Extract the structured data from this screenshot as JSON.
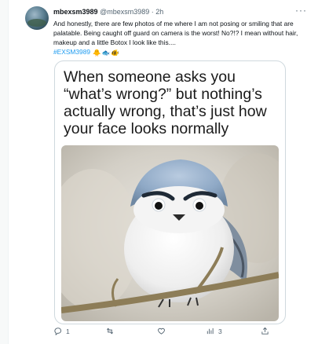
{
  "tweet": {
    "name": "mbexsm3989",
    "handle": "@mbexsm3989",
    "separator": "·",
    "time": "2h",
    "more_label": "···",
    "text": "And honestly, there are few photos of me where I am not posing or smiling that are palatable. Being caught off guard on camera is the worst! No?!? I mean without hair, makeup and a little Botox I look like this....",
    "hashtag": "#EXSM3989",
    "emojis": [
      "🐥",
      "🐟",
      "🐠"
    ]
  },
  "media": {
    "caption": "When someone asks you “what’s wrong?” but nothing’s actually wrong, that’s just how your face looks normally",
    "photo_subject": "grumpy-looking small blue-gray bird on a branch"
  },
  "actions": {
    "reply_count": "1",
    "retweet_count": "",
    "like_count": "",
    "views_count": "3"
  },
  "icons": [
    "reply-icon",
    "retweet-icon",
    "like-icon",
    "views-icon",
    "bookmark-icon",
    "share-icon"
  ],
  "colors": {
    "link": "#1d9bf0",
    "muted": "#536471",
    "text": "#0f1419",
    "border": "#cfd9de"
  }
}
